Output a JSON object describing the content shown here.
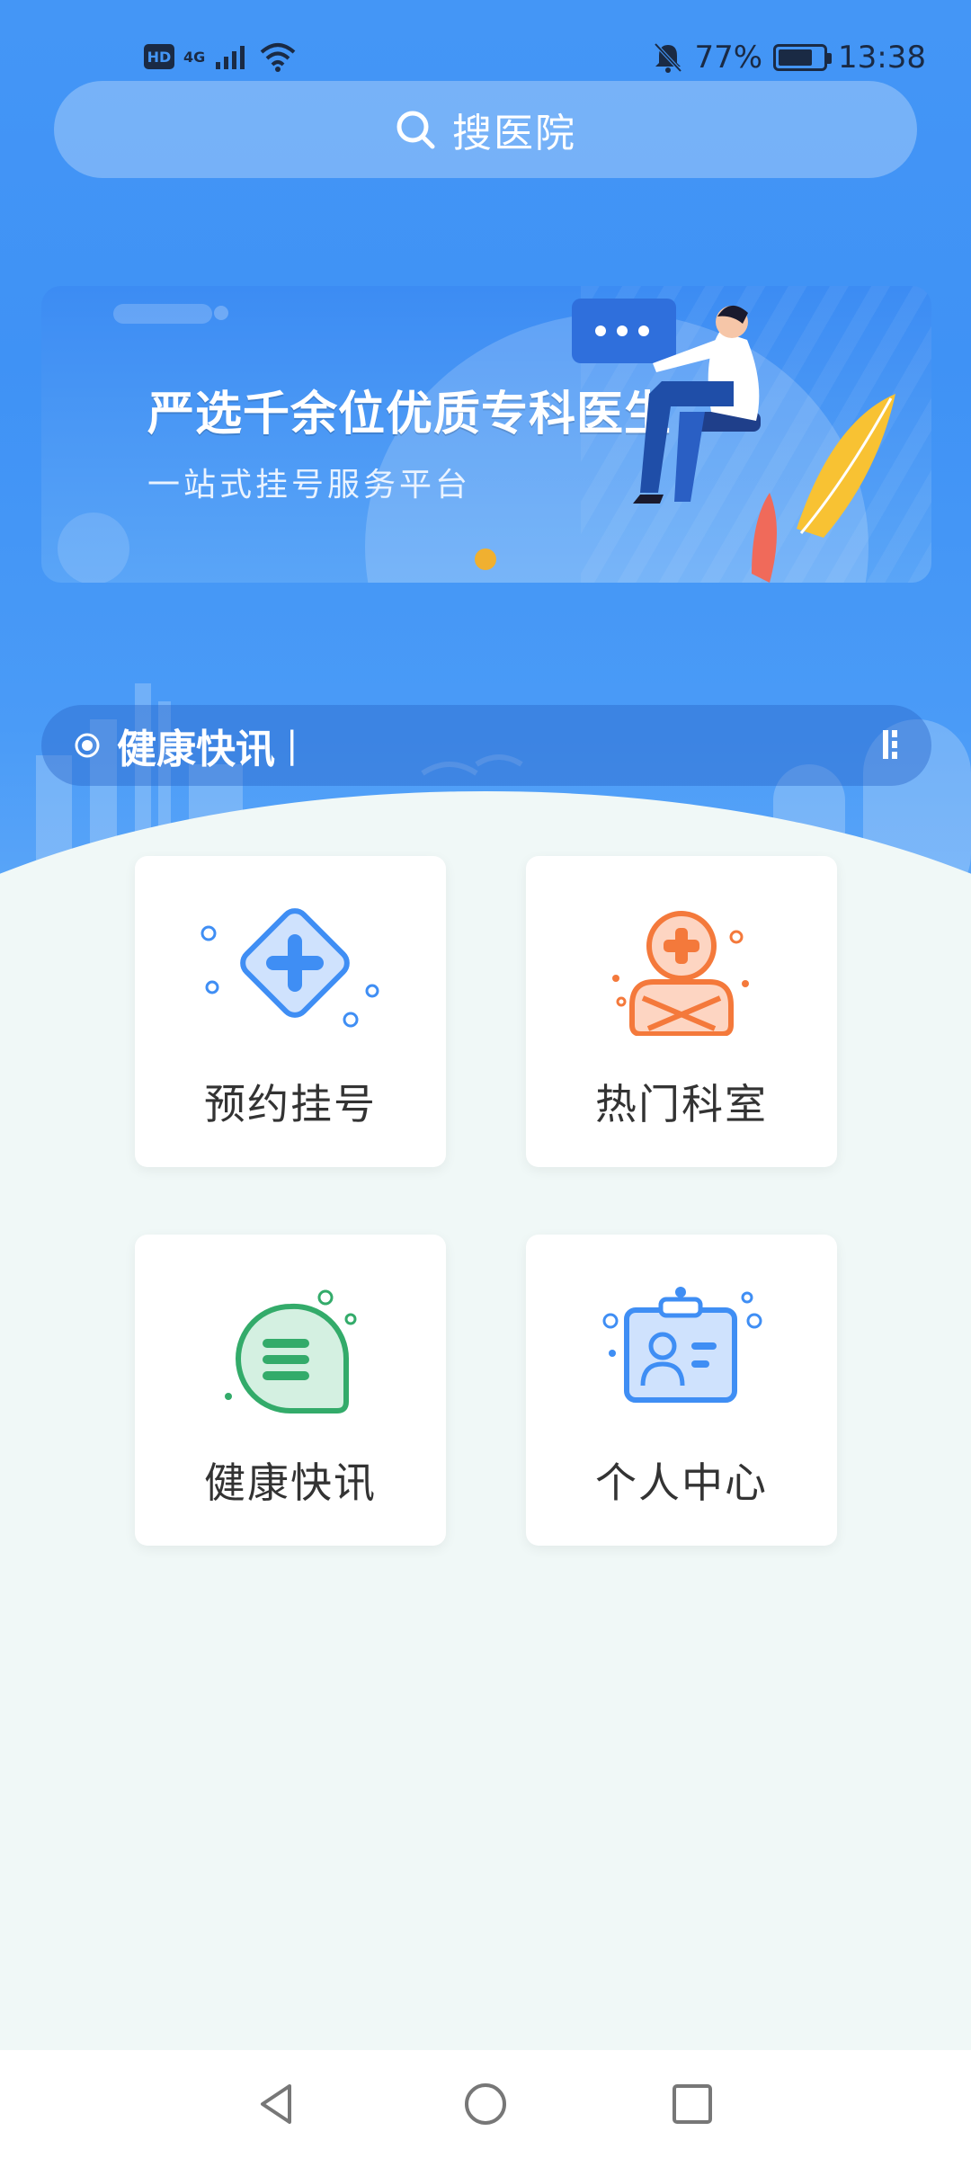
{
  "status_bar": {
    "hd": "HD",
    "network": "4G",
    "battery_percent": "77%",
    "battery_level": 0.77,
    "time": "13:38"
  },
  "search": {
    "label": "搜医院",
    "icon": "search-icon"
  },
  "banner": {
    "title": "严选千余位优质专科医生",
    "subtitle": "一站式挂号服务平台",
    "indicator_color": "#f0b030"
  },
  "ticker": {
    "label": "健康快讯",
    "cursor": "|"
  },
  "grid": [
    {
      "label": "预约挂号",
      "icon": "register-plus-icon",
      "color": "#3f8ef4"
    },
    {
      "label": "热门科室",
      "icon": "doctor-icon",
      "color": "#f4793b"
    },
    {
      "label": "健康快讯",
      "icon": "message-icon",
      "color": "#33ab6a"
    },
    {
      "label": "个人中心",
      "icon": "id-card-icon",
      "color": "#3f8ef4"
    }
  ],
  "nav": [
    "back-icon",
    "home-icon",
    "recent-apps-icon"
  ],
  "colors": {
    "primary": "#4496f6",
    "background": "#f0f8f7"
  }
}
